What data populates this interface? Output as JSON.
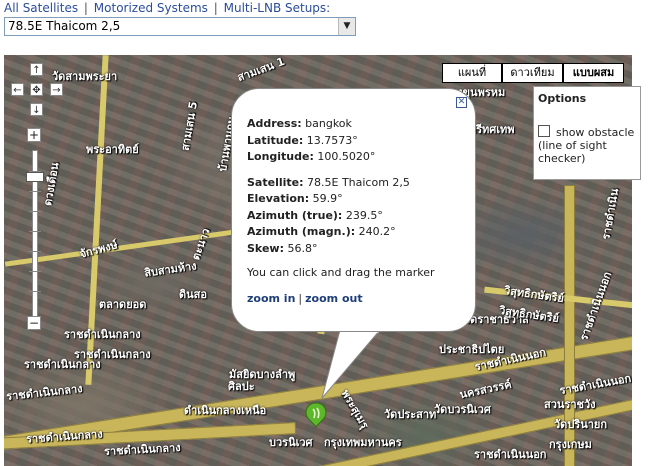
{
  "nav": {
    "links": [
      "All Satellites",
      "Motorized Systems",
      "Multi-LNB Setups:"
    ],
    "separator": "|"
  },
  "satellite_select": {
    "value": "78.5E Thaicom 2,5"
  },
  "map": {
    "type_buttons": [
      {
        "label": "แผนที่",
        "active": false
      },
      {
        "label": "ดาวเทียม",
        "active": false
      },
      {
        "label": "แบบผสม",
        "active": true
      }
    ],
    "labels": [
      "วัดสามพระยา",
      "บางขุนพรหม",
      "สามเสน 1",
      "สามเสน 5",
      "ตรีทศเทพ",
      "วิสุทธิกษัตริย์",
      "ดวงเดือน",
      "พระอาทิตย์",
      "จักรพงษ์",
      "สิบสามห้าง",
      "ตลาดยอด",
      "ราชดำเนินกลาง",
      "พระสุเมรุ",
      "บวรนิเวศ",
      "กรุงเทพมหานคร",
      "ศิลปะ",
      "ราชดำเนินกลาง",
      "ราชดำเนินนอก",
      "ราชดำเนินกลาง",
      "ราชดำเนินกลาง",
      "ราชดำเนินกลาง",
      "ตะนาว",
      "บ้านพานถม",
      "ดินสอ",
      "ดำเนินกลางเหนือ",
      "มัสยิดบางลำพู",
      "ราชดำเนินนอก",
      "ราชดำเนินกลาง",
      "ราชดำเนิน",
      "กรุงเกษม",
      "สวนราชวัง",
      "นครสวรรค์",
      "ราชดำเนินนอก",
      "วัดราชาธิวาส",
      "วัดปรินายก",
      "วัดบวรนิเวศ",
      "วิสุทธิกษัตริย์",
      "ประชาธิปไตย",
      "ราชดำเนินนอก",
      "วัดประสาท"
    ],
    "icons": {
      "pan": [
        "arrow-up-icon",
        "arrow-left-icon",
        "center-icon",
        "arrow-right-icon",
        "arrow-down-icon"
      ],
      "zoom": [
        "zoom-in-icon",
        "zoom-out-icon"
      ]
    }
  },
  "options": {
    "title": "Options",
    "show_obstacle_label": "show obstacle (line of sight checker)",
    "show_obstacle_checked": false
  },
  "popup": {
    "close_icon": "close-icon",
    "address_label": "Address:",
    "address_value": "bangkok",
    "latitude_label": "Latitude:",
    "latitude_value": "13.7573°",
    "longitude_label": "Longitude:",
    "longitude_value": "100.5020°",
    "satellite_label": "Satellite:",
    "satellite_value": "78.5E Thaicom 2,5",
    "elevation_label": "Elevation:",
    "elevation_value": "59.9°",
    "az_true_label": "Azimuth (true):",
    "az_true_value": "239.5°",
    "az_mag_label": "Azimuth (magn.):",
    "az_mag_value": "240.2°",
    "skew_label": "Skew:",
    "skew_value": "56.8°",
    "note": "You can click and drag the marker",
    "zoom_in": "zoom in",
    "zoom_sep": "|",
    "zoom_out": "zoom out"
  },
  "marker": {
    "icon": "map-marker-icon",
    "color": "#5cb82a"
  }
}
